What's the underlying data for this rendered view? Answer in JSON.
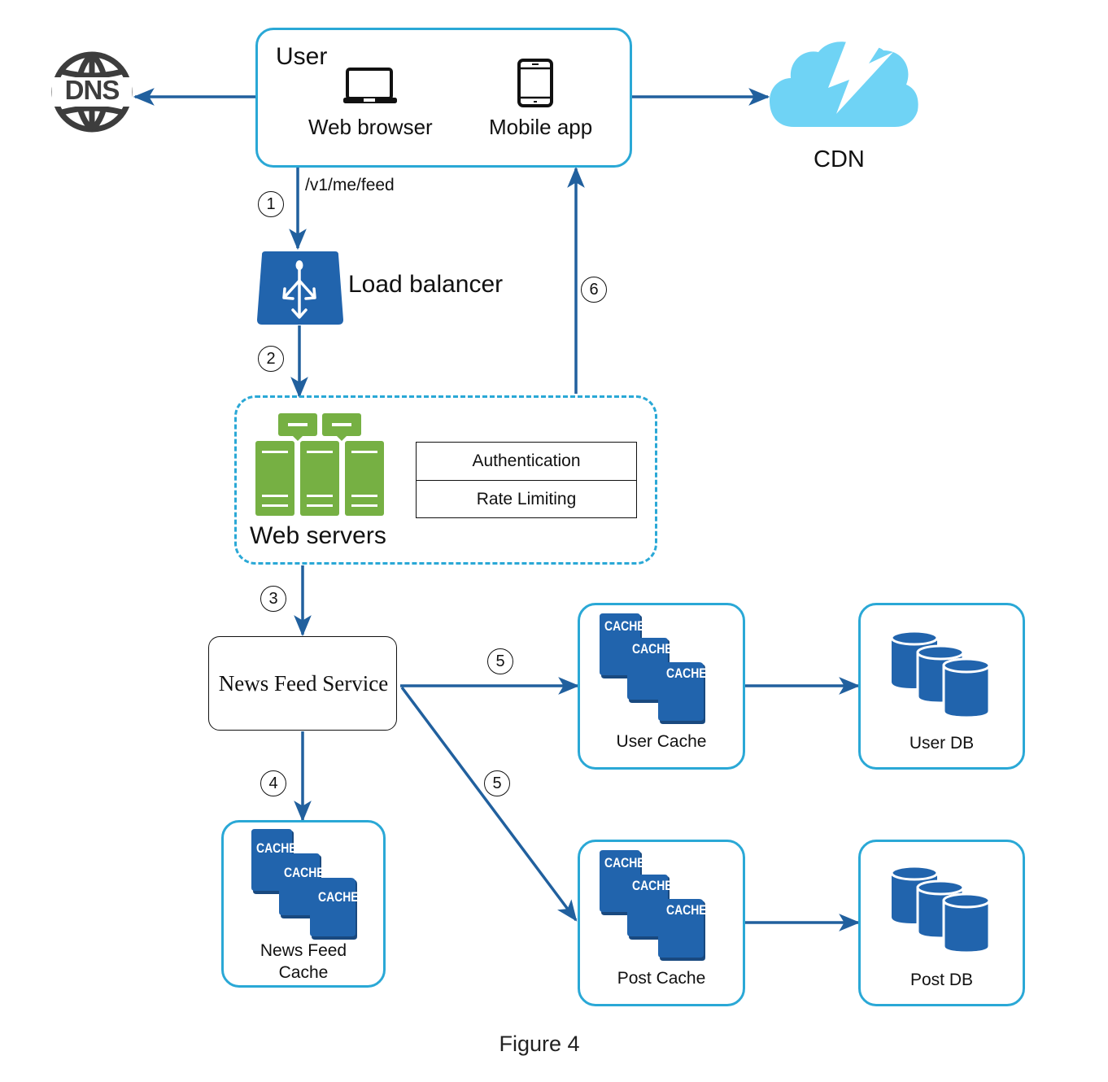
{
  "figure": {
    "caption": "Figure 4"
  },
  "colors": {
    "arrow": "#21609e",
    "box_border": "#2aa8d6",
    "icon_blue": "#2164ad",
    "server_green": "#76b043",
    "cdn_cloud": "#6fd3f5",
    "dns_icon": "#3d3d3d"
  },
  "user": {
    "title": "User",
    "clients": [
      {
        "label": "Web browser",
        "icon": "laptop-icon"
      },
      {
        "label": "Mobile app",
        "icon": "mobile-phone-icon"
      }
    ]
  },
  "dns": {
    "label": "DNS",
    "icon": "dns-globe-icon"
  },
  "cdn": {
    "label": "CDN",
    "icon": "cloud-lightning-icon"
  },
  "request": {
    "endpoint": "/v1/me/feed"
  },
  "load_balancer": {
    "label": "Load balancer",
    "icon": "load-balancer-icon"
  },
  "web_servers": {
    "label": "Web servers",
    "icon": "server-rack-icon",
    "middleware": [
      "Authentication",
      "Rate Limiting"
    ]
  },
  "news_feed_service": {
    "label": "News Feed Service"
  },
  "caches": {
    "chip_label": "CACHE",
    "news_feed_cache": {
      "label_line1": "News Feed",
      "label_line2": "Cache"
    },
    "user_cache": {
      "label": "User Cache"
    },
    "post_cache": {
      "label": "Post Cache"
    }
  },
  "databases": {
    "user_db": {
      "label": "User DB"
    },
    "post_db": {
      "label": "Post DB"
    }
  },
  "steps": {
    "s1": "1",
    "s2": "2",
    "s3": "3",
    "s4": "4",
    "s5a": "5",
    "s5b": "5",
    "s6": "6"
  },
  "edges": [
    {
      "from": "user",
      "to": "dns"
    },
    {
      "from": "user",
      "to": "cdn"
    },
    {
      "from": "user",
      "to": "load_balancer",
      "step": "1",
      "label": "/v1/me/feed"
    },
    {
      "from": "load_balancer",
      "to": "web_servers",
      "step": "2"
    },
    {
      "from": "web_servers",
      "to": "news_feed_service",
      "step": "3"
    },
    {
      "from": "news_feed_service",
      "to": "news_feed_cache",
      "step": "4"
    },
    {
      "from": "news_feed_service",
      "to": "user_cache",
      "step": "5"
    },
    {
      "from": "news_feed_service",
      "to": "post_cache",
      "step": "5"
    },
    {
      "from": "user_cache",
      "to": "user_db"
    },
    {
      "from": "post_cache",
      "to": "post_db"
    },
    {
      "from": "web_servers",
      "to": "user",
      "step": "6"
    }
  ]
}
